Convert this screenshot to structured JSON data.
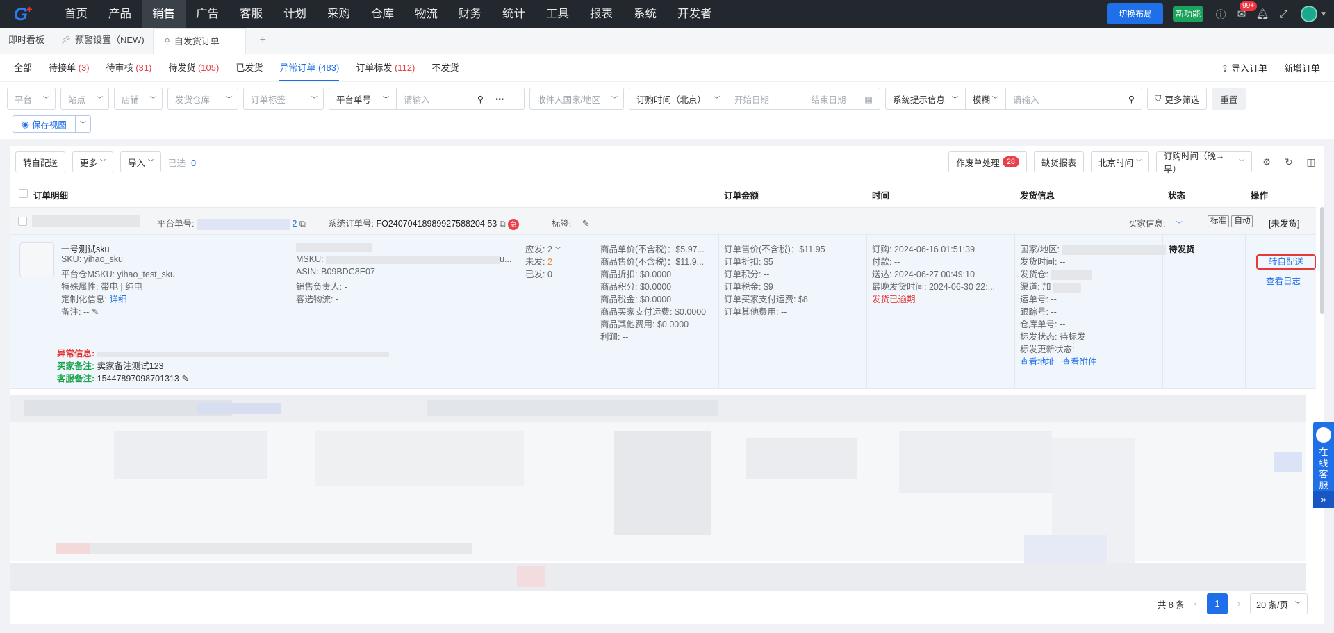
{
  "nav": {
    "menu": [
      "首页",
      "产品",
      "销售",
      "广告",
      "客服",
      "计划",
      "采购",
      "仓库",
      "物流",
      "财务",
      "统计",
      "工具",
      "报表",
      "系统",
      "开发者"
    ],
    "active": "销售",
    "switch_layout": "切换布局",
    "new_feature": "新功能",
    "msg_count": "99+"
  },
  "page_tabs": {
    "items": [
      {
        "label": "即时看板"
      },
      {
        "label": "预警设置（NEW)"
      },
      {
        "label": "自发货订单"
      }
    ],
    "add": "+"
  },
  "status_tabs": {
    "items": [
      {
        "label": "全部",
        "count": ""
      },
      {
        "label": "待接单",
        "count": "(3)"
      },
      {
        "label": "待审核",
        "count": "(31)"
      },
      {
        "label": "待发货",
        "count": "(105)"
      },
      {
        "label": "已发货",
        "count": ""
      },
      {
        "label": "异常订单",
        "count": "(483)"
      },
      {
        "label": "订单标发",
        "count": "(112)"
      },
      {
        "label": "不发货",
        "count": ""
      }
    ],
    "import_order": "导入订单",
    "new_order": "新增订单"
  },
  "filters": {
    "platform": "平台",
    "site": "站点",
    "shop": "店铺",
    "warehouse": "发货仓库",
    "order_tag": "订单标签",
    "platform_no": "平台单号",
    "input_placeholder": "请输入",
    "country": "收件人国家/地区",
    "time_type": "订购时间（北京）",
    "start_date": "开始日期",
    "date_sep": "–",
    "end_date": "结束日期",
    "system_hint": "系统提示信息",
    "fuzzy": "模糊",
    "input_placeholder2": "请输入",
    "more_filters": "更多筛选",
    "reset": "重置",
    "save_view": "保存视图"
  },
  "actions": {
    "self_ship": "转自配送",
    "more": "更多",
    "import": "导入",
    "selected_label": "已选",
    "selected_count": "0",
    "void_process": "作废单处理",
    "void_count": "28",
    "stockout_report": "缺货报表",
    "beijing_time": "北京时间",
    "sort": "订购时间（晚→早）"
  },
  "table_headers": {
    "detail": "订单明细",
    "amount": "订单金额",
    "time": "时间",
    "shipping": "发货信息",
    "status": "状态",
    "ops": "操作"
  },
  "order": {
    "platform_no_label": "平台单号:",
    "platform_no_tail": "2",
    "sys_no_label": "系统订单号:",
    "sys_no": "FO24070418989927588204 53",
    "tag_label": "标签: --",
    "buyer_info": "买家信息: --",
    "tag_std": "标准",
    "tag_auto": "自动",
    "ship_state": "[未发货]",
    "product_name": "一号测试sku",
    "sku": "SKU:  yihao_sku",
    "msku_platform": "平台仓MSKU:  yihao_test_sku",
    "special": "特殊属性:  带电 | 纯电",
    "custom": "定制化信息:",
    "custom_link": "详细",
    "remark": "备注: --",
    "msku_label": "MSKU:",
    "msku_tail": "u...",
    "asin": "ASIN:  B09BDC8E07",
    "sales_owner": "销售负责人:  -",
    "logistics": "客选物流:  -",
    "should_ship": "应发:  2",
    "unshipped_label": "未发:",
    "unshipped": "2",
    "shipped": "已发:  0",
    "error_label": "异常信息:",
    "buyer_remark_label": "买家备注:",
    "buyer_remark": "卖家备注测试123",
    "cs_remark_label": "客服备注:",
    "cs_remark": "15447897098701313",
    "prices": [
      "商品单价(不含税)：$5.97...",
      "商品售价(不含税)：$11.9...",
      "商品折扣:  $0.0000",
      "商品积分:  $0.0000",
      "商品税金:  $0.0000",
      "商品买家支付运费:  $0.0000",
      "商品其他费用:  $0.0000",
      "利润:  --"
    ],
    "amounts": [
      "订单售价(不含税)：$11.95",
      "订单折扣:  $5",
      "订单积分:  --",
      "订单税金:  $9",
      "订单买家支付运费:  $8",
      "订单其他费用:  --"
    ],
    "times": [
      "订购:  2024-06-16 01:51:39",
      "付款:  --",
      "送达:  2024-06-27 00:49:10",
      "最晚发货时间:  2024-06-30 22:..."
    ],
    "overdue": "发货已逾期",
    "ship": [
      "国家/地区:",
      "发货时间:  --",
      "发货仓:",
      "渠道:  加",
      "运单号:  --",
      "跟踪号:  --",
      "仓库单号:  --",
      "标发状态:  待标发",
      "标发更新状态:  --"
    ],
    "view_address": "查看地址",
    "view_attach": "查看附件",
    "status": "待发货",
    "op_self_ship": "转自配送",
    "op_log": "查看日志"
  },
  "pager": {
    "total": "共 8 条",
    "page": "1",
    "size": "20 条/页"
  },
  "cs_widget": {
    "text": [
      "在",
      "线",
      "客",
      "服"
    ],
    "more": "»"
  }
}
